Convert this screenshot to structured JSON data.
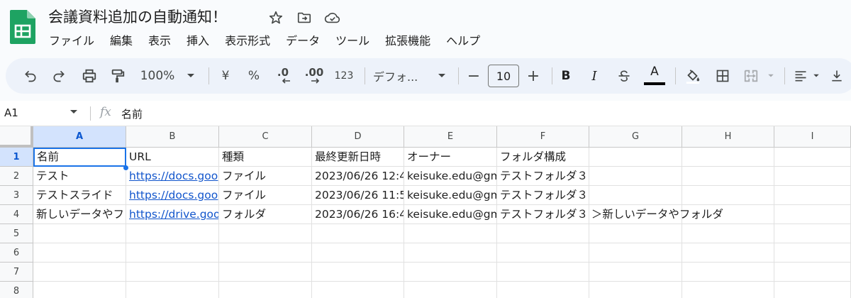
{
  "doc": {
    "title": "会議資料追加の自動通知！"
  },
  "menu": [
    "ファイル",
    "編集",
    "表示",
    "挿入",
    "表示形式",
    "データ",
    "ツール",
    "拡張機能",
    "ヘルプ"
  ],
  "toolbar": {
    "zoom": "100%",
    "currency": "¥",
    "percent": "%",
    "decrease_decimal": ".0",
    "increase_decimal": ".00",
    "number_format": "123",
    "font": "デフォ...",
    "minus": "−",
    "font_size": "10",
    "plus": "+",
    "bold": "B",
    "italic": "I",
    "text_color_letter": "A",
    "text_color": "#000000"
  },
  "formula_bar": {
    "cell_ref": "A1",
    "fx": "fx",
    "value": "名前"
  },
  "grid": {
    "columns": [
      "A",
      "B",
      "C",
      "D",
      "E",
      "F",
      "G",
      "H",
      "I"
    ],
    "rows": [
      "1",
      "2",
      "3",
      "4",
      "5",
      "6",
      "7",
      "8"
    ],
    "cells": [
      [
        "名前",
        "URL",
        "種類",
        "最終更新日時",
        "オーナー",
        "フォルダ構成"
      ],
      [
        "テスト",
        "https://docs.goog",
        "ファイル",
        "2023/06/26 12:4!",
        "keisuke.edu@gm",
        "テストフォルダ３"
      ],
      [
        "テストスライド",
        "https://docs.goog",
        "ファイル",
        "2023/06/26 11:5:",
        "keisuke.edu@gm",
        "テストフォルダ３"
      ],
      [
        "新しいデータやフ",
        "https://drive.goog",
        "フォルダ",
        "2023/06/26 16:4(",
        "keisuke.edu@gm",
        "テストフォルダ３ ＞新しいデータやフォルダ"
      ]
    ]
  }
}
